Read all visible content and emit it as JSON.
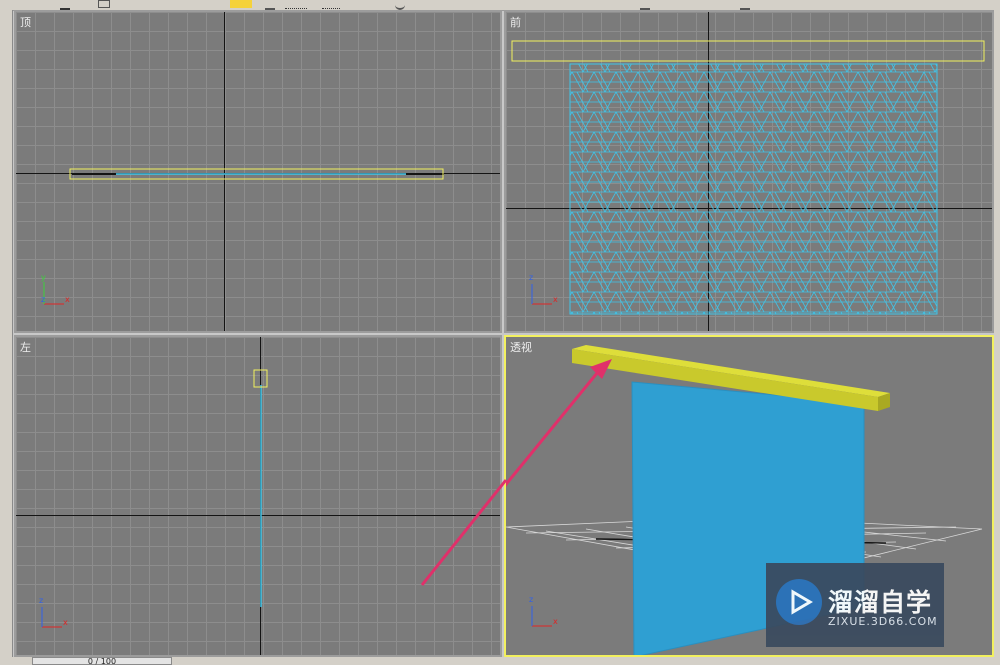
{
  "viewports": {
    "top": {
      "label": "顶"
    },
    "front": {
      "label": "前"
    },
    "left": {
      "label": "左"
    },
    "perspective": {
      "label": "透视"
    }
  },
  "axis_labels": {
    "x": "x",
    "y": "y",
    "z": "z"
  },
  "timeline": {
    "frame": "0 / 100"
  },
  "watermark": {
    "title": "溜溜自学",
    "url": "ZIXUE.3D66.COM"
  },
  "colors": {
    "viewport_bg": "#7b7b7b",
    "grid": "#8d8d8d",
    "selection": "#f2f05e",
    "mesh": "#3fc4e8",
    "plane_fill": "#2f9fd2",
    "beam": "#c9c92c",
    "arrow": "#e0306a"
  },
  "icons": [
    "select-arrow-icon",
    "rotate-icon",
    "scale-icon",
    "layer-icon"
  ]
}
